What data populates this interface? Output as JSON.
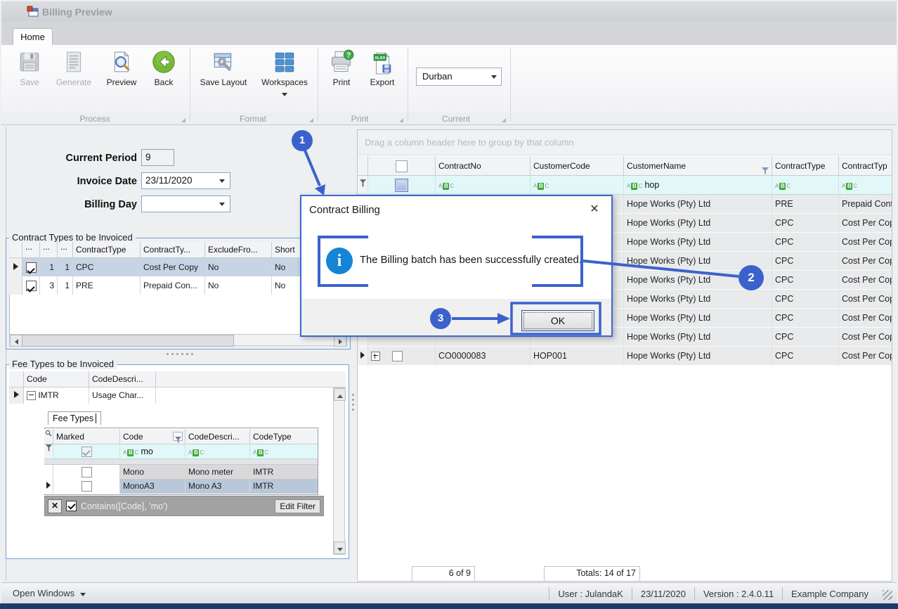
{
  "window": {
    "title": "Billing Preview"
  },
  "colors": {
    "annotation": "#3b62cc",
    "dialog_border": "#3c68d0",
    "info_icon": "#1584d7",
    "filter_row_bg": "#e2f8f8",
    "selected_row": "#c6d4e4",
    "abc_green": "#3aa93a"
  },
  "ribbon": {
    "tab": "Home",
    "groups": [
      {
        "label": "Process",
        "buttons": [
          {
            "label": "Save",
            "icon": "save-floppy-icon",
            "disabled": true
          },
          {
            "label": "Generate",
            "icon": "generate-document-icon",
            "disabled": true
          },
          {
            "label": "Preview",
            "icon": "preview-magnifier-icon",
            "disabled": false
          },
          {
            "label": "Back",
            "icon": "back-arrow-icon",
            "disabled": false
          }
        ]
      },
      {
        "label": "Format",
        "buttons": [
          {
            "label": "Save Layout",
            "icon": "save-layout-icon",
            "disabled": false
          },
          {
            "label": "Workspaces",
            "icon": "workspaces-grid-icon",
            "disabled": false,
            "dropdown": true
          }
        ]
      },
      {
        "label": "Print",
        "buttons": [
          {
            "label": "Print",
            "icon": "print-icon",
            "disabled": false
          },
          {
            "label": "Export",
            "icon": "export-xlsx-icon",
            "disabled": false
          }
        ]
      },
      {
        "label": "Current",
        "combo_value": "Durban"
      }
    ]
  },
  "form": {
    "current_period": {
      "label": "Current Period",
      "value": "9"
    },
    "invoice_date": {
      "label": "Invoice Date",
      "value": "23/11/2020"
    },
    "billing_day": {
      "label": "Billing Day",
      "value": ""
    }
  },
  "contract_types": {
    "group_title": "Contract Types to be Invoiced",
    "columns": [
      "...",
      "...",
      "...",
      "ContractType",
      "ContractTy...",
      "ExcludeFro...",
      "Short"
    ],
    "rows": [
      {
        "checked": true,
        "col1": "1",
        "col2": "1",
        "type": "CPC",
        "desc": "Cost Per Copy",
        "exclude": "No",
        "short": "No",
        "selected": true
      },
      {
        "checked": true,
        "col1": "3",
        "col2": "1",
        "type": "PRE",
        "desc": "Prepaid Con...",
        "exclude": "No",
        "short": "No",
        "selected": false
      }
    ]
  },
  "fee_types": {
    "group_title": "Fee Types to be Invoiced",
    "columns": [
      "Code",
      "CodeDescri..."
    ],
    "master_row": {
      "code": "IMTR",
      "desc": "Usage Char..."
    },
    "detail": {
      "tab_label": "Fee Types",
      "columns": [
        "Marked",
        "Code",
        "CodeDescri...",
        "CodeType"
      ],
      "filter_row": {
        "code": "mo"
      },
      "rows": [
        {
          "marked": false,
          "code": "Mono",
          "desc": "Mono meter",
          "type": "IMTR",
          "selected": false
        },
        {
          "marked": false,
          "code": "MonoA3",
          "desc": "Mono A3",
          "type": "IMTR",
          "selected": true
        }
      ],
      "filter_bar": {
        "condition": "Contains([Code], 'mo')",
        "edit_button": "Edit Filter"
      }
    }
  },
  "billing_grid": {
    "group_by_hint": "Drag a column header here to group by that column",
    "columns": [
      "ContractNo",
      "CustomerCode",
      "CustomerName",
      "ContractType",
      "ContractTyp"
    ],
    "filter_row": {
      "customer_name": "hop"
    },
    "rows": [
      {
        "no": "",
        "code": "",
        "name": "Hope Works (Pty) Ltd",
        "type": "PRE",
        "type_desc": "Prepaid Cont"
      },
      {
        "no": "",
        "code": "",
        "name": "Hope Works (Pty) Ltd",
        "type": "CPC",
        "type_desc": "Cost Per Cop"
      },
      {
        "no": "",
        "code": "",
        "name": "Hope Works (Pty) Ltd",
        "type": "CPC",
        "type_desc": "Cost Per Cop"
      },
      {
        "no": "",
        "code": "",
        "name": "Hope Works (Pty) Ltd",
        "type": "CPC",
        "type_desc": "Cost Per Cop"
      },
      {
        "no": "",
        "code": "",
        "name": "Hope Works (Pty) Ltd",
        "type": "CPC",
        "type_desc": "Cost Per Cop"
      },
      {
        "no": "",
        "code": "",
        "name": "Hope Works (Pty) Ltd",
        "type": "CPC",
        "type_desc": "Cost Per Cop"
      },
      {
        "no": "",
        "code": "",
        "name": "Hope Works (Pty) Ltd",
        "type": "CPC",
        "type_desc": "Cost Per Cop"
      },
      {
        "no": "",
        "code": "",
        "name": "Hope Works (Pty) Ltd",
        "type": "CPC",
        "type_desc": "Cost Per Cop"
      },
      {
        "no": "CO0000083",
        "code": "HOP001",
        "name": "Hope Works (Pty) Ltd",
        "type": "CPC",
        "type_desc": "Cost Per Cop",
        "expandable": true
      }
    ],
    "summary": {
      "count": "6 of 9",
      "totals": "Totals: 14 of 17"
    }
  },
  "dialog": {
    "title": "Contract Billing",
    "message": "The Billing batch has been successfully created.",
    "ok_label": "OK",
    "close_glyph": "✕"
  },
  "annotations": {
    "step1": "1",
    "step2": "2",
    "step3": "3"
  },
  "status_bar": {
    "open_windows": "Open Windows",
    "user": "User : JulandaK",
    "date": "23/11/2020",
    "version": "Version : 2.4.0.11",
    "company": "Example Company"
  }
}
